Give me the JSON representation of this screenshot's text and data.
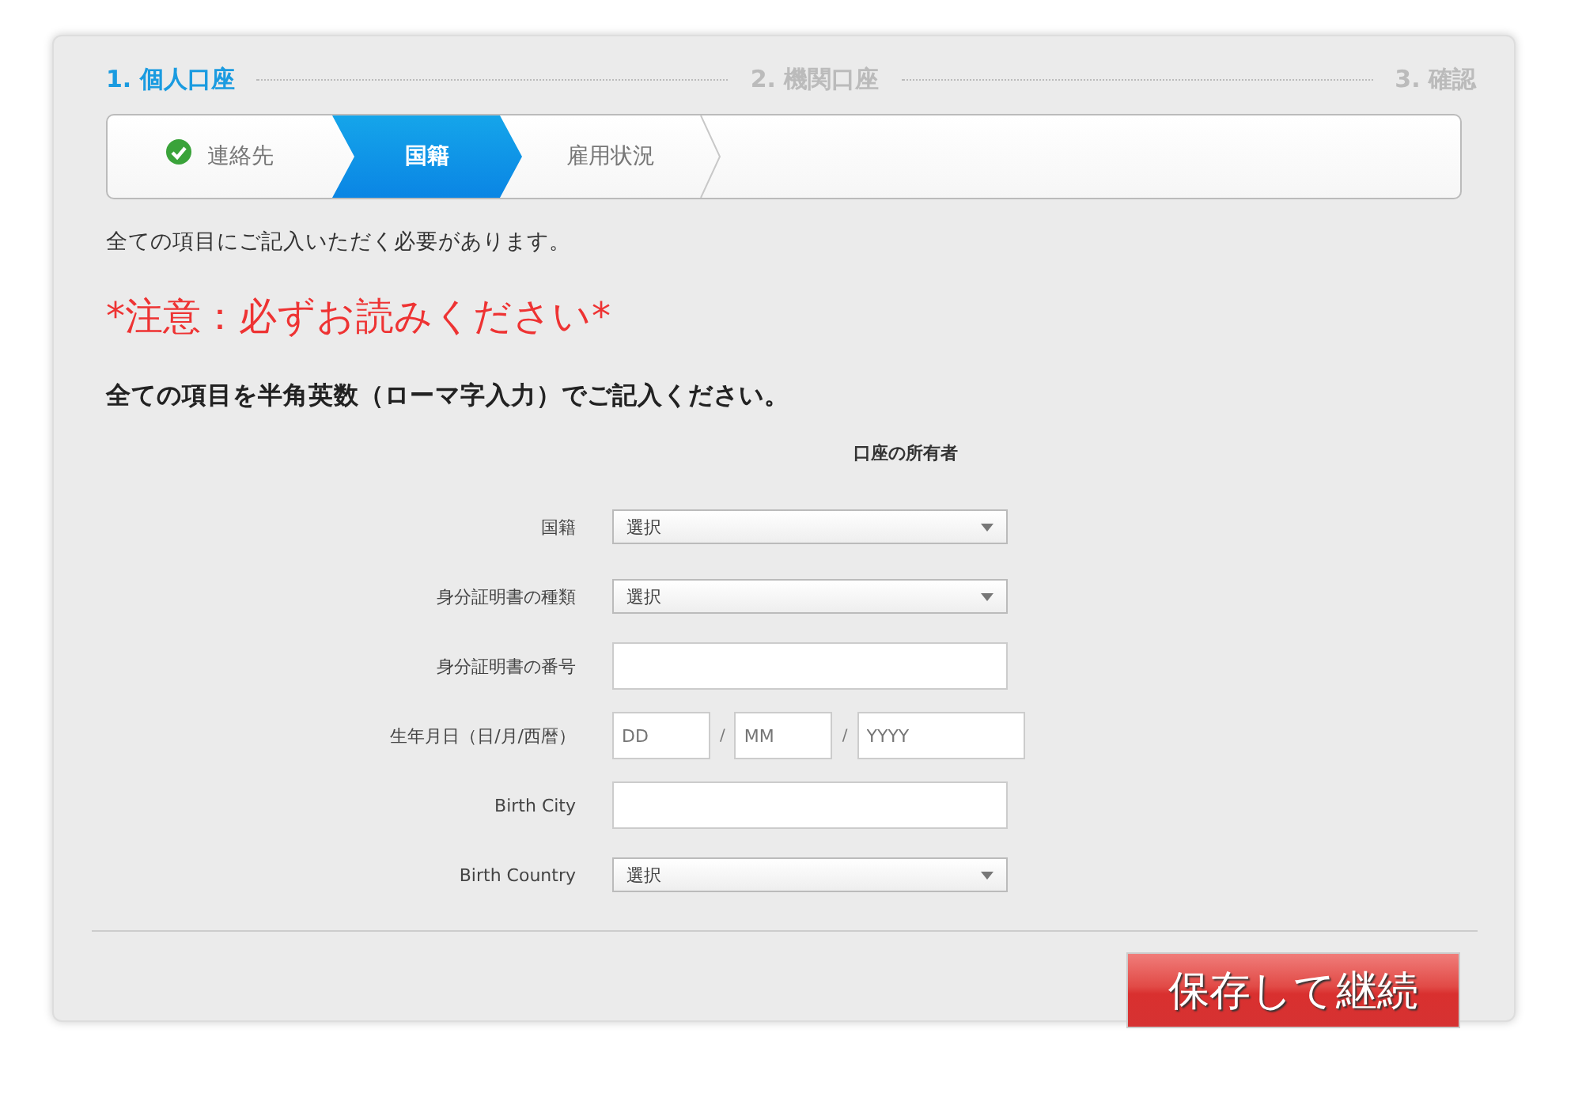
{
  "steps": [
    {
      "label": "1. 個人口座",
      "selected": true
    },
    {
      "label": "2. 機関口座",
      "selected": false
    },
    {
      "label": "3. 確認",
      "selected": false
    }
  ],
  "substeps": [
    {
      "label": "連絡先",
      "selected": false,
      "done": true
    },
    {
      "label": "国籍",
      "selected": true,
      "done": false
    },
    {
      "label": "雇用状況",
      "selected": false,
      "done": false
    }
  ],
  "intro": "全ての項目にご記入いただく必要があります。",
  "warning": "*注意：必ずお読みください*",
  "instruction": "全ての項目を半角英数（ローマ字入力）でご記入ください。",
  "section_title": "口座の所有者",
  "fields": [
    {
      "label": "国籍",
      "kind": "select",
      "value": "選択"
    },
    {
      "label": "身分証明書の種類",
      "kind": "select",
      "value": "選択"
    },
    {
      "label": "身分証明書の番号",
      "kind": "text"
    },
    {
      "label": "生年月日（日/月/西暦）",
      "kind": "date",
      "parts": [
        {
          "placeholder": "DD"
        },
        {
          "separator": "/",
          "placeholder": "MM"
        },
        {
          "separator": "/",
          "placeholder": "YYYY"
        }
      ]
    },
    {
      "label": "Birth City",
      "kind": "text"
    },
    {
      "label": "Birth Country",
      "kind": "select",
      "value": "選択"
    }
  ],
  "submit": "保存して継続"
}
